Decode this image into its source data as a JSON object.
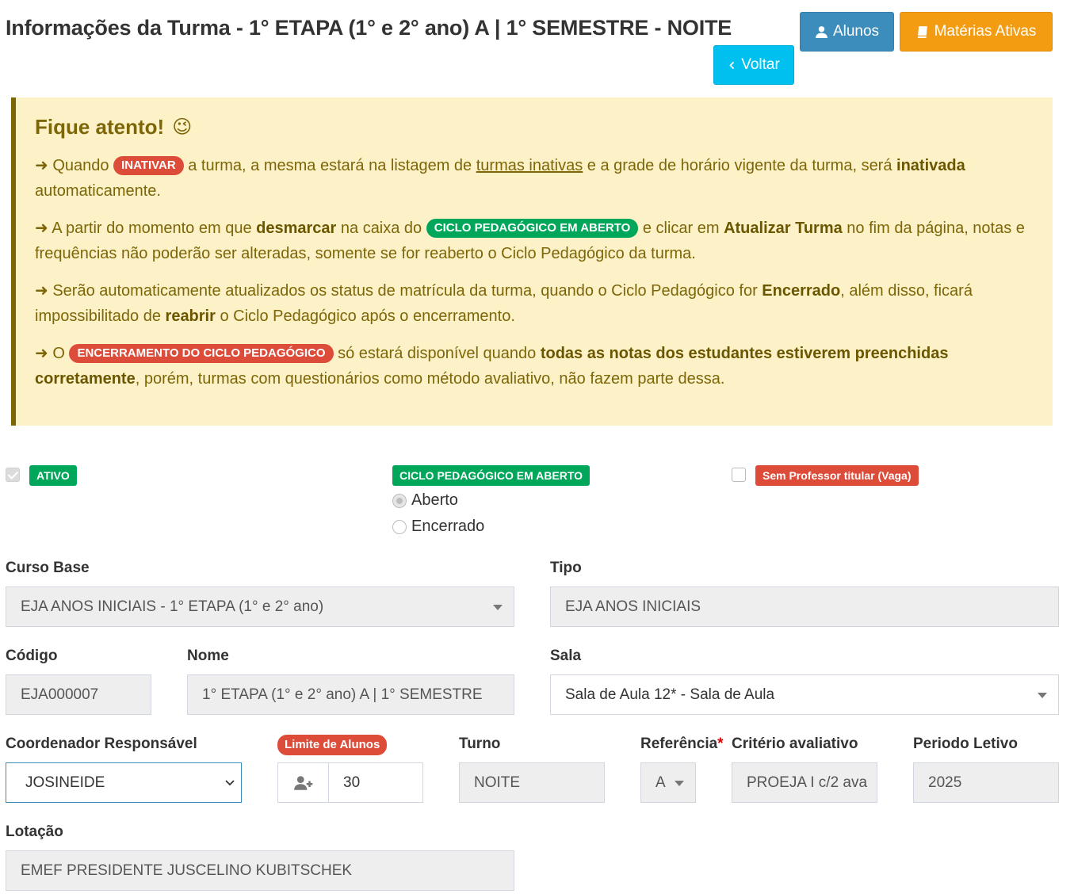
{
  "header": {
    "title": "Informações da Turma - 1° ETAPA (1° e 2° ano) A | 1° SEMESTRE - NOITE",
    "btn_alunos": "Alunos",
    "btn_materias": "Matérias Ativas",
    "btn_voltar": "Voltar"
  },
  "alert": {
    "title": "Fique atento!",
    "emoji": "😉",
    "p1_a": " Quando ",
    "p1_pill": "INATIVAR",
    "p1_b": " a turma, a mesma estará na listagem de ",
    "p1_link": "turmas inativas",
    "p1_c": " e a grade de horário vigente da turma, será ",
    "p1_bold": "inativada",
    "p1_d": " automaticamente.",
    "p2_a": " A partir do momento em que ",
    "p2_bold1": "desmarcar",
    "p2_b": " na caixa do ",
    "p2_pill": "CICLO PEDAGÓGICO EM ABERTO",
    "p2_c": " e clicar em ",
    "p2_bold2": "Atualizar Turma",
    "p2_d": " no fim da página, notas e frequências não poderão ser alteradas, somente se for reaberto o Ciclo Pedagógico da turma.",
    "p3_a": " Serão automaticamente atualizados os status de matrícula da turma, quando o Ciclo Pedagógico for ",
    "p3_bold1": "Encerrado",
    "p3_b": ", além disso, ficará impossibilitado de ",
    "p3_bold2": "reabrir",
    "p3_c": " o Ciclo Pedagógico após o encerramento.",
    "p4_a": " O ",
    "p4_pill": "ENCERRAMENTO DO CICLO PEDAGÓGICO",
    "p4_b": " só estará disponível quando ",
    "p4_bold": "todas as notas dos estudantes estiverem preenchidas corretamente",
    "p4_c": ", porém, turmas com questionários como método avaliativo, não fazem parte dessa."
  },
  "status": {
    "ativo_label": "ATIVO",
    "ativo_checked": true,
    "ciclo_label": "CICLO PEDAGÓGICO EM ABERTO",
    "ciclo_options": [
      "Aberto",
      "Encerrado"
    ],
    "ciclo_selected": "Aberto",
    "sem_prof_label": "Sem Professor titular (Vaga)",
    "sem_prof_checked": false
  },
  "form": {
    "curso_base_label": "Curso Base",
    "curso_base_value": "EJA ANOS INICIAIS - 1° ETAPA (1° e 2° ano)",
    "tipo_label": "Tipo",
    "tipo_value": "EJA ANOS INICIAIS",
    "codigo_label": "Código",
    "codigo_value": "EJA000007",
    "nome_label": "Nome",
    "nome_value": "1° ETAPA (1° e 2° ano) A | 1° SEMESTRE",
    "sala_label": "Sala",
    "sala_value": "Sala de Aula 12* - Sala de Aula",
    "coordenador_label": "Coordenador Responsável",
    "coordenador_value": "JOSINEIDE",
    "limite_label": "Limite de Alunos",
    "limite_value": "30",
    "turno_label": "Turno",
    "turno_value": "NOITE",
    "referencia_label": "Referência",
    "referencia_required": "*",
    "referencia_value": "A",
    "criterio_label": "Critério avaliativo",
    "criterio_value": "PROEJA I c/2 ava",
    "periodo_label": "Periodo Letivo",
    "periodo_value": "2025",
    "lotacao_label": "Lotação",
    "lotacao_value": "EMEF PRESIDENTE JUSCELINO KUBITSCHEK"
  },
  "colors": {
    "primary": "#3c8dbc",
    "warning": "#f39c12",
    "info": "#00c0ef",
    "success": "#00a65a",
    "danger": "#dd4b39",
    "alert_bg": "#fcf1c7",
    "alert_text": "#7d6608"
  }
}
